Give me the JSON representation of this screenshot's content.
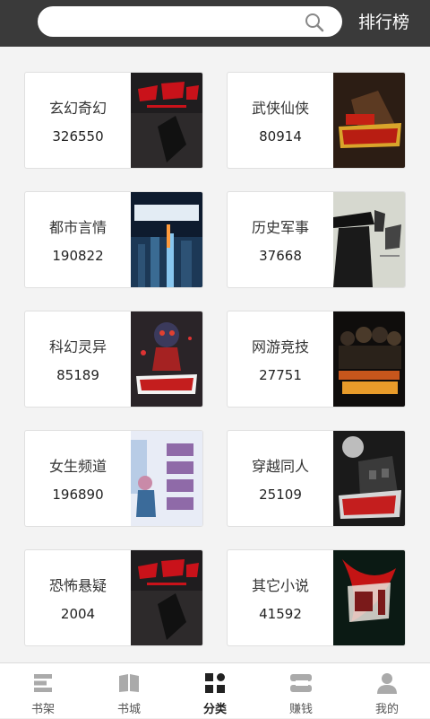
{
  "header": {
    "search_placeholder": "",
    "rank_label": "排行榜"
  },
  "categories": [
    {
      "name": "玄幻奇幻",
      "count": "326550",
      "cover_icon": "book-cover-dark-red-title"
    },
    {
      "name": "武侠仙侠",
      "count": "80914",
      "cover_icon": "book-cover-warrior-red"
    },
    {
      "name": "都市言情",
      "count": "190822",
      "cover_icon": "book-cover-city-blue"
    },
    {
      "name": "历史军事",
      "count": "37668",
      "cover_icon": "book-cover-hat-silhouette"
    },
    {
      "name": "科幻灵异",
      "count": "85189",
      "cover_icon": "book-cover-cartoon-dark"
    },
    {
      "name": "网游竞技",
      "count": "27751",
      "cover_icon": "book-cover-group-gold"
    },
    {
      "name": "女生频道",
      "count": "196890",
      "cover_icon": "book-cover-pastel-girl"
    },
    {
      "name": "穿越同人",
      "count": "25109",
      "cover_icon": "book-cover-haunted-house"
    },
    {
      "name": "恐怖悬疑",
      "count": "2004",
      "cover_icon": "book-cover-dark-red-title"
    },
    {
      "name": "其它小说",
      "count": "41592",
      "cover_icon": "book-cover-phoenix-red"
    }
  ],
  "tabs": [
    {
      "label": "书架",
      "icon": "bookshelf-icon"
    },
    {
      "label": "书城",
      "icon": "book-open-icon"
    },
    {
      "label": "分类",
      "icon": "category-grid-icon",
      "active": true
    },
    {
      "label": "赚钱",
      "icon": "coin-stack-icon"
    },
    {
      "label": "我的",
      "icon": "user-profile-icon"
    }
  ],
  "colors": {
    "topbar": "#3a3a3a",
    "tab_icon": "#aaaaaa",
    "tab_active": "#222222"
  }
}
